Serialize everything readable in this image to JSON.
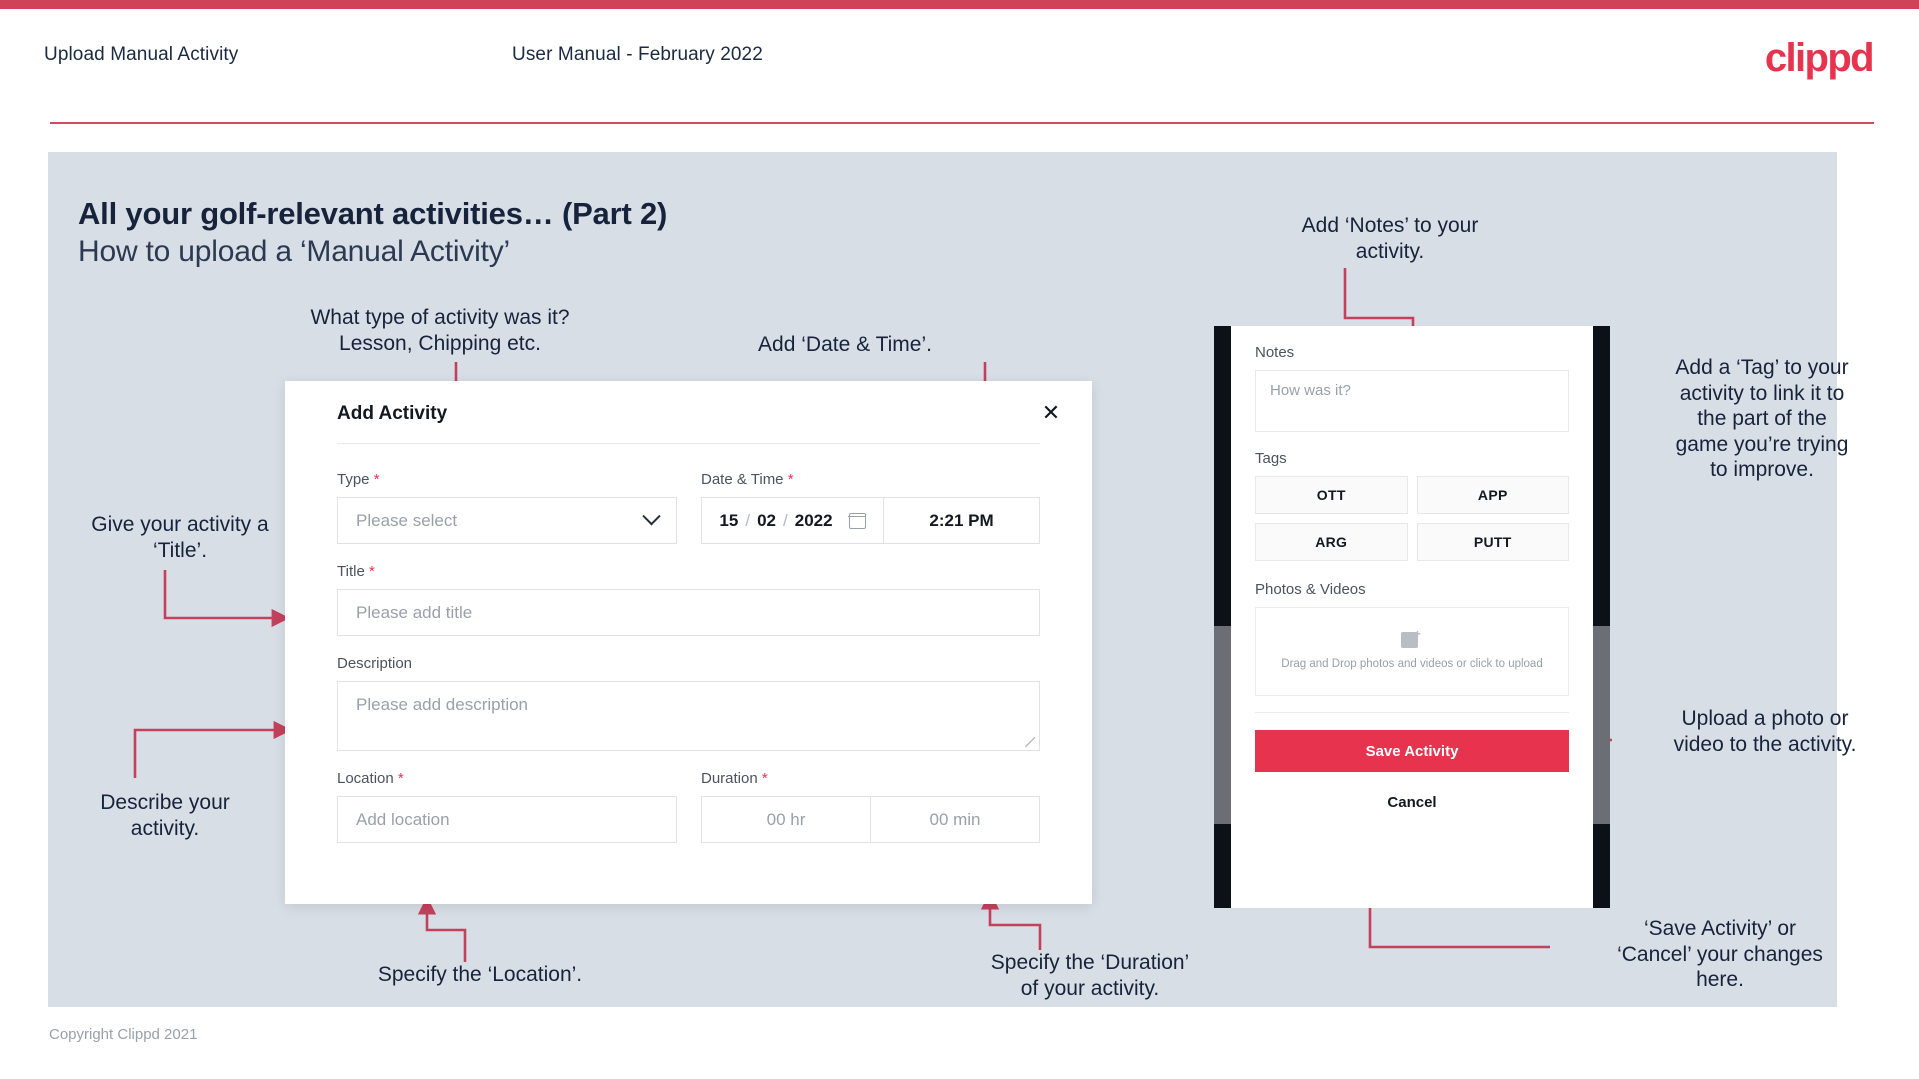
{
  "header": {
    "title": "Upload Manual Activity",
    "subtitle": "User Manual - February 2022",
    "brand": "clippd",
    "accent_color": "#e8334f",
    "rule_color": "#cf4257"
  },
  "slide": {
    "title": "All your golf-relevant activities… (Part 2)",
    "subtitle": "How to upload a ‘Manual Activity’",
    "background_color": "#d8dee6"
  },
  "annotations": {
    "type": "What type of activity was it?\nLesson, Chipping etc.",
    "datetime": "Add ‘Date & Time’.",
    "title": "Give your activity a\n‘Title’.",
    "description": "Describe your\nactivity.",
    "location": "Specify the ‘Location’.",
    "duration": "Specify the ‘Duration’\nof your activity.",
    "notes": "Add ‘Notes’ to your\nactivity.",
    "tags": "Add a ‘Tag’ to your\nactivity to link it to\nthe part of the\ngame you’re trying\nto improve.",
    "photos": "Upload a photo or\nvideo to the activity.",
    "save_cancel": "‘Save Activity’ or\n‘Cancel’ your changes\nhere."
  },
  "dialog": {
    "title": "Add Activity",
    "close_icon": "close-icon",
    "fields": {
      "type": {
        "label": "Type",
        "required": "*",
        "value": "Please select",
        "chevron_icon": "chevron-down-icon"
      },
      "datetime": {
        "label": "Date & Time",
        "required": "*",
        "day": "15",
        "sep1": "/",
        "month": "02",
        "sep2": "/",
        "year": "2022",
        "calendar_icon": "calendar-icon",
        "time": "2:21 PM"
      },
      "title": {
        "label": "Title",
        "required": "*",
        "placeholder": "Please add title"
      },
      "description": {
        "label": "Description",
        "placeholder": "Please add description"
      },
      "location": {
        "label": "Location",
        "required": "*",
        "placeholder": "Add location"
      },
      "duration": {
        "label": "Duration",
        "required": "*",
        "hours": "00 hr",
        "minutes": "00 min"
      }
    }
  },
  "phone": {
    "notes_label": "Notes",
    "notes_placeholder": "How was it?",
    "tags_label": "Tags",
    "tags": [
      "OTT",
      "APP",
      "ARG",
      "PUTT"
    ],
    "photos_label": "Photos & Videos",
    "dropzone_text": "Drag and Drop photos and videos or click to upload",
    "dropzone_icon": "add-image-icon",
    "save_label": "Save Activity",
    "cancel_label": "Cancel",
    "save_color": "#e8334f"
  },
  "footer": {
    "copyright": "Copyright Clippd 2021"
  }
}
